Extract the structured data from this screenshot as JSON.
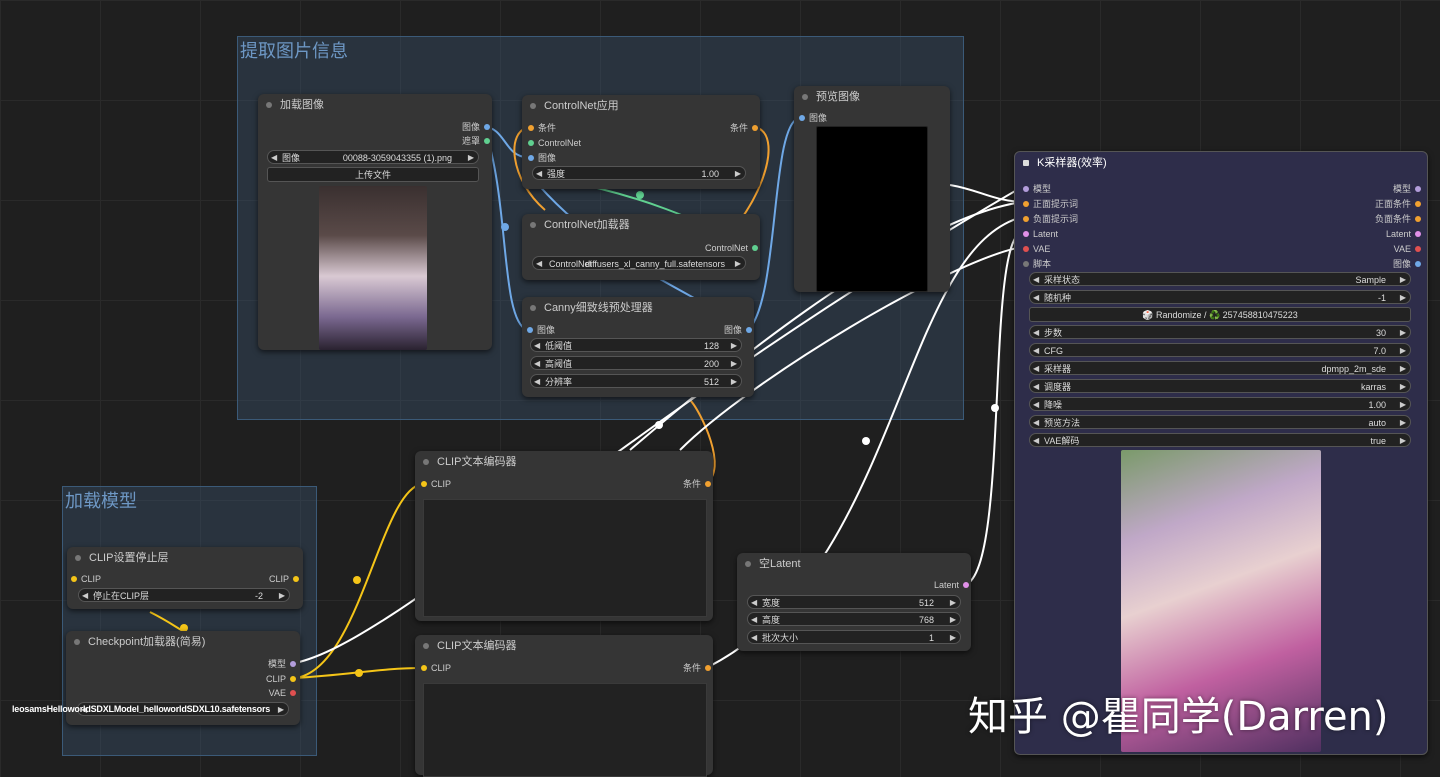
{
  "groups": {
    "extract": {
      "title": "提取图片信息"
    },
    "load_model": {
      "title": "加载模型"
    }
  },
  "colors": {
    "wire_image": "#6fa8e6",
    "wire_cond": "#f0a030",
    "wire_clip": "#f5c518",
    "wire_latent": "#e090e8",
    "wire_white": "#ffffff",
    "wire_controlnet": "#60d090",
    "wire_vae": "#e05050"
  },
  "load_image": {
    "title": "加载图像",
    "out_image": "图像",
    "out_mask": "遮罩",
    "image_label": "图像",
    "image_value": "00088-3059043355 (1).png",
    "upload_label": "上传文件"
  },
  "controlnet_apply": {
    "title": "ControlNet应用",
    "in_cond": "条件",
    "in_controlnet": "ControlNet",
    "in_image": "图像",
    "out_cond": "条件",
    "strength_label": "强度",
    "strength_value": "1.00"
  },
  "controlnet_loader": {
    "title": "ControlNet加载器",
    "out_controlnet": "ControlNet",
    "name_label": "ControlNet",
    "name_value": "diffusers_xl_canny_full.safetensors"
  },
  "canny": {
    "title": "Canny细致线预处理器",
    "in_image": "图像",
    "out_image": "图像",
    "low_label": "低阈值",
    "low_value": "128",
    "high_label": "高阈值",
    "high_value": "200",
    "res_label": "分辨率",
    "res_value": "512"
  },
  "preview": {
    "title": "预览图像",
    "in_image": "图像"
  },
  "ksampler": {
    "title": "K采样器(效率)",
    "inputs": [
      "模型",
      "正面提示词",
      "负面提示词",
      "Latent",
      "VAE",
      "脚本"
    ],
    "outputs": [
      "模型",
      "正面条件",
      "负面条件",
      "Latent",
      "VAE",
      "图像"
    ],
    "seed_button": "🎲 Randomize / ♻️ 257458810475223",
    "widgets": [
      {
        "label": "采样状态",
        "value": "Sample"
      },
      {
        "label": "随机种",
        "value": "-1"
      },
      {
        "label": "步数",
        "value": "30"
      },
      {
        "label": "CFG",
        "value": "7.0"
      },
      {
        "label": "采样器",
        "value": "dpmpp_2m_sde"
      },
      {
        "label": "调度器",
        "value": "karras"
      },
      {
        "label": "降噪",
        "value": "1.00"
      },
      {
        "label": "预览方法",
        "value": "auto"
      },
      {
        "label": "VAE解码",
        "value": "true"
      }
    ]
  },
  "clip_encode_1": {
    "title": "CLIP文本编码器",
    "in_clip": "CLIP",
    "out_cond": "条件"
  },
  "clip_encode_2": {
    "title": "CLIP文本编码器",
    "in_clip": "CLIP",
    "out_cond": "条件"
  },
  "empty_latent": {
    "title": "空Latent",
    "out_latent": "Latent",
    "width_label": "宽度",
    "width_value": "512",
    "height_label": "高度",
    "height_value": "768",
    "batch_label": "批次大小",
    "batch_value": "1"
  },
  "clip_skip": {
    "title": "CLIP设置停止层",
    "in_clip": "CLIP",
    "out_clip": "CLIP",
    "layer_label": "停止在CLIP层",
    "layer_value": "-2"
  },
  "checkpoint": {
    "title": "Checkpoint加载器(简易)",
    "out_model": "模型",
    "out_clip": "CLIP",
    "out_vae": "VAE",
    "overflow_text": "leosamsHelloworldSDXLModel_helloworldSDXL10.safetensors"
  },
  "watermark": "知乎 @瞿同学(Darren)"
}
